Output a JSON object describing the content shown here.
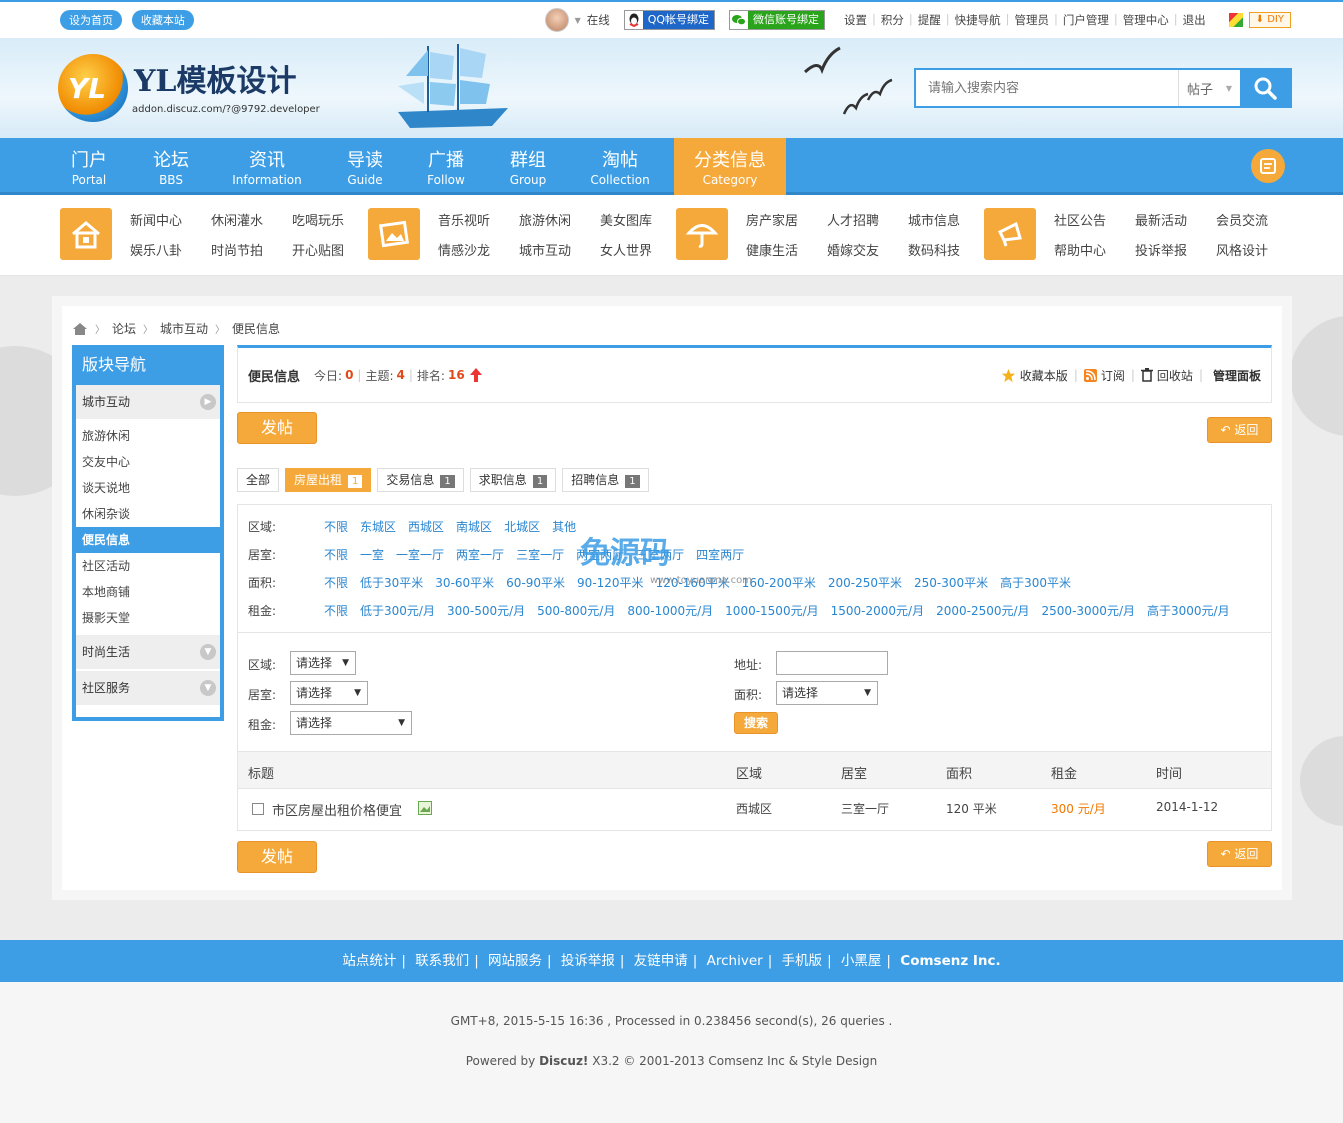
{
  "topbar": {
    "set_home": "设为首页",
    "bookmark": "收藏本站",
    "online": "在线",
    "qq_bind": "QQ帐号绑定",
    "wechat_bind": "微信账号绑定",
    "links": [
      "设置",
      "积分",
      "提醒",
      "快捷导航",
      "管理员",
      "门户管理",
      "管理中心",
      "退出"
    ],
    "diy": "DIY"
  },
  "header": {
    "logo_mark": "YL",
    "logo_text": "YL模板设计",
    "logo_sub": "addon.discuz.com/?@9792.developer",
    "search_placeholder": "请输入搜索内容",
    "search_type": "帖子"
  },
  "nav": [
    {
      "cn": "门户",
      "en": "Portal"
    },
    {
      "cn": "论坛",
      "en": "BBS"
    },
    {
      "cn": "资讯",
      "en": "Information"
    },
    {
      "cn": "导读",
      "en": "Guide"
    },
    {
      "cn": "广播",
      "en": "Follow"
    },
    {
      "cn": "群组",
      "en": "Group"
    },
    {
      "cn": "淘帖",
      "en": "Collection"
    },
    {
      "cn": "分类信息",
      "en": "Category"
    }
  ],
  "subnav": [
    {
      "icon": "home-icon",
      "links": [
        "新闻中心",
        "休闲灌水",
        "吃喝玩乐",
        "娱乐八卦",
        "时尚节拍",
        "开心贴图"
      ]
    },
    {
      "icon": "picture-icon",
      "links": [
        "音乐视听",
        "旅游休闲",
        "美女图库",
        "情感沙龙",
        "城市互动",
        "女人世界"
      ]
    },
    {
      "icon": "umbrella-icon",
      "links": [
        "房产家居",
        "人才招聘",
        "城市信息",
        "健康生活",
        "婚嫁交友",
        "数码科技"
      ]
    },
    {
      "icon": "megaphone-icon",
      "links": [
        "社区公告",
        "最新活动",
        "会员交流",
        "帮助中心",
        "投诉举报",
        "风格设计"
      ]
    }
  ],
  "breadcrumb": [
    "论坛",
    "城市互动",
    "便民信息"
  ],
  "sidebar": {
    "title": "版块导航",
    "cat1": "城市互动",
    "items": [
      "旅游休闲",
      "交友中心",
      "谈天说地",
      "休闲杂谈",
      "便民信息",
      "社区活动",
      "本地商铺",
      "摄影天堂"
    ],
    "cat2": "时尚生活",
    "cat3": "社区服务"
  },
  "forum": {
    "name": "便民信息",
    "today_label": "今日:",
    "today": "0",
    "threads_label": "主题:",
    "threads": "4",
    "rank_label": "排名:",
    "rank": "16",
    "fav": "收藏本版",
    "rss": "订阅",
    "recycle": "回收站",
    "manage": "管理面板"
  },
  "buttons": {
    "post": "发帖",
    "back": "返回",
    "search": "搜索"
  },
  "tabs": [
    {
      "label": "全部"
    },
    {
      "label": "房屋出租",
      "count": "1"
    },
    {
      "label": "交易信息",
      "count": "1"
    },
    {
      "label": "求职信息",
      "count": "1"
    },
    {
      "label": "招聘信息",
      "count": "1"
    }
  ],
  "filters": [
    {
      "label": "区域:",
      "options": [
        "不限",
        "东城区",
        "西城区",
        "南城区",
        "北城区",
        "其他"
      ]
    },
    {
      "label": "居室:",
      "options": [
        "不限",
        "一室",
        "一室一厅",
        "两室一厅",
        "三室一厅",
        "两室两厅",
        "三室两厅",
        "四室两厅"
      ]
    },
    {
      "label": "面积:",
      "options": [
        "不限",
        "低于30平米",
        "30-60平米",
        "60-90平米",
        "90-120平米",
        "120-160平米",
        "160-200平米",
        "200-250平米",
        "250-300平米",
        "高于300平米"
      ]
    },
    {
      "label": "租金:",
      "options": [
        "不限",
        "低于300元/月",
        "300-500元/月",
        "500-800元/月",
        "800-1000元/月",
        "1000-1500元/月",
        "1500-2000元/月",
        "2000-2500元/月",
        "2500-3000元/月",
        "高于3000元/月"
      ]
    }
  ],
  "form": {
    "region_label": "区域:",
    "room_label": "居室:",
    "rent_label": "租金:",
    "addr_label": "地址:",
    "area_label": "面积:",
    "placeholder": "请选择"
  },
  "table": {
    "headers": [
      "标题",
      "区域",
      "居室",
      "面积",
      "租金",
      "时间"
    ],
    "rows": [
      {
        "title": "市区房屋出租价格便宜",
        "region": "西城区",
        "room": "三室一厅",
        "area": "120 平米",
        "rent": "300 元/月",
        "time": "2014-1-12"
      }
    ]
  },
  "footer": {
    "links": [
      "站点统计",
      "联系我们",
      "网站服务",
      "投诉举报",
      "友链申请",
      "Archiver",
      "手机版",
      "小黑屋"
    ],
    "company": "Comsenz Inc.",
    "stats": "GMT+8, 2015-5-15 16:36 , Processed in 0.238456 second(s), 26 queries .",
    "powered_prefix": "Powered by ",
    "powered_name": "Discuz!",
    "powered_suffix": " X3.2 © 2001-2013 Comsenz Inc & Style Design"
  },
  "watermark": {
    "text": "免源码",
    "url": "www.toyuanma.com"
  },
  "colors": {
    "primary": "#3d9ee6",
    "accent": "#f5a93a",
    "link": "#2a86d0",
    "highlight": "#e04a1a"
  }
}
